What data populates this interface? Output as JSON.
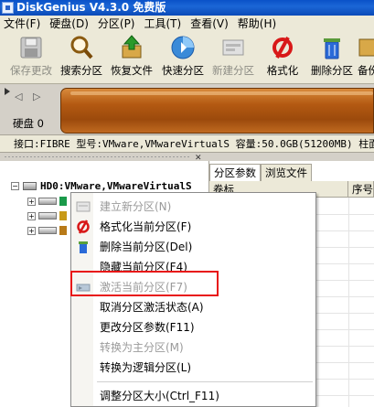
{
  "window": {
    "title": "DiskGenius V4.3.0 免费版"
  },
  "menubar": {
    "items": [
      "文件(F)",
      "硬盘(D)",
      "分区(P)",
      "工具(T)",
      "查看(V)",
      "帮助(H)"
    ]
  },
  "toolbar": {
    "buttons": [
      {
        "label": "保存更改",
        "icon": "save-icon",
        "enabled": false
      },
      {
        "label": "搜索分区",
        "icon": "search-icon",
        "enabled": true
      },
      {
        "label": "恢复文件",
        "icon": "recover-files-icon",
        "enabled": true
      },
      {
        "label": "快速分区",
        "icon": "quick-partition-icon",
        "enabled": true
      },
      {
        "label": "新建分区",
        "icon": "new-partition-icon",
        "enabled": false
      },
      {
        "label": "格式化",
        "icon": "format-icon",
        "enabled": true
      },
      {
        "label": "删除分区",
        "icon": "delete-partition-icon",
        "enabled": true
      },
      {
        "label": "备份分",
        "icon": "backup-icon",
        "enabled": true
      }
    ]
  },
  "diskmap": {
    "nav_arrows": "◁ ▷",
    "disk_label": "硬盘 0"
  },
  "infobar": {
    "text": "接口:FIBRE  型号:VMware,VMwareVirtualS  容量:50.0GB(51200MB)  柱面"
  },
  "tree": {
    "root_label": "HD0:VMware,VMwareVirtualS"
  },
  "tabs": [
    "分区参数",
    "浏览文件"
  ],
  "grid": {
    "columns": [
      "卷标",
      "序号"
    ]
  },
  "context_menu": {
    "items": [
      {
        "label": "建立新分区(N)",
        "enabled": false,
        "icon": "new-partition-icon"
      },
      {
        "label": "格式化当前分区(F)",
        "enabled": true,
        "icon": "format-icon"
      },
      {
        "label": "删除当前分区(Del)",
        "enabled": true,
        "icon": "delete-icon"
      },
      {
        "label": "隐藏当前分区(F4)",
        "enabled": true,
        "icon": ""
      },
      {
        "label": "激活当前分区(F7)",
        "enabled": false,
        "icon": "activate-icon"
      },
      {
        "label": "取消分区激活状态(A)",
        "enabled": true,
        "icon": ""
      },
      {
        "label": "更改分区参数(F11)",
        "enabled": true,
        "icon": ""
      },
      {
        "label": "转换为主分区(M)",
        "enabled": false,
        "icon": ""
      },
      {
        "label": "转换为逻辑分区(L)",
        "enabled": true,
        "icon": ""
      },
      {
        "label": "调整分区大小(Ctrl_F11)",
        "enabled": true,
        "icon": ""
      }
    ]
  },
  "colors": {
    "highlight_box": "#e81414",
    "title_bar": "#0a52c8",
    "partition_bar": "#b45a12"
  }
}
